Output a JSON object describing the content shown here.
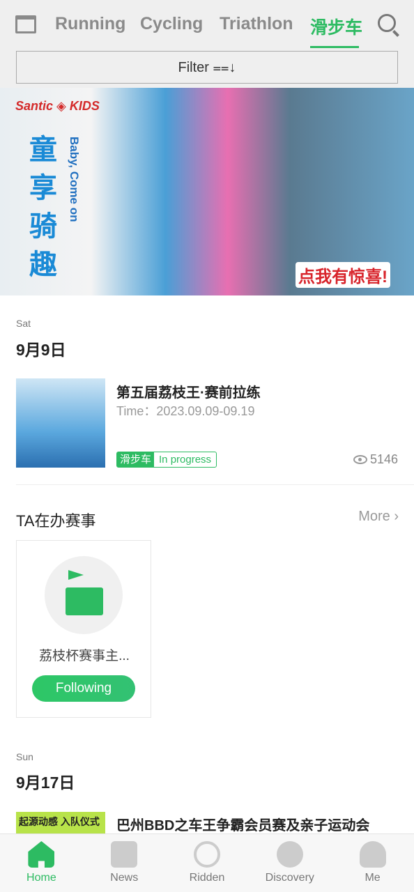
{
  "tabs": [
    "Running",
    "Cycling",
    "Triathlon",
    "滑步车"
  ],
  "active_tab": "滑步车",
  "filter_label": "Filter ⩵↓",
  "banner": {
    "logo": "Santic ◈ KIDS",
    "slogan_cn": "童享骑趣",
    "slogan_en": "Baby, Come on",
    "cta": "点我有惊喜!"
  },
  "sections": [
    {
      "day": "Sat",
      "date": "9月9日",
      "event": {
        "title": "第五届荔枝王·赛前拉练",
        "time": "Time：2023.09.09-09.19",
        "category": "滑步车",
        "status": "In progress",
        "views": "5146"
      }
    },
    {
      "day": "Sun",
      "date": "9月17日",
      "event": {
        "title": "巴州BBD之车王争霸会员赛及亲子运动会",
        "thumb_text": "起源动感 入队仪式"
      }
    }
  ],
  "organizers": {
    "title": "TA在办赛事",
    "more": "More",
    "items": [
      {
        "name": "荔枝杯赛事主...",
        "follow_label": "Following"
      }
    ]
  },
  "bottom_nav": [
    "Home",
    "News",
    "Ridden",
    "Discovery",
    "Me"
  ],
  "colors": {
    "accent": "#2dbb62"
  }
}
